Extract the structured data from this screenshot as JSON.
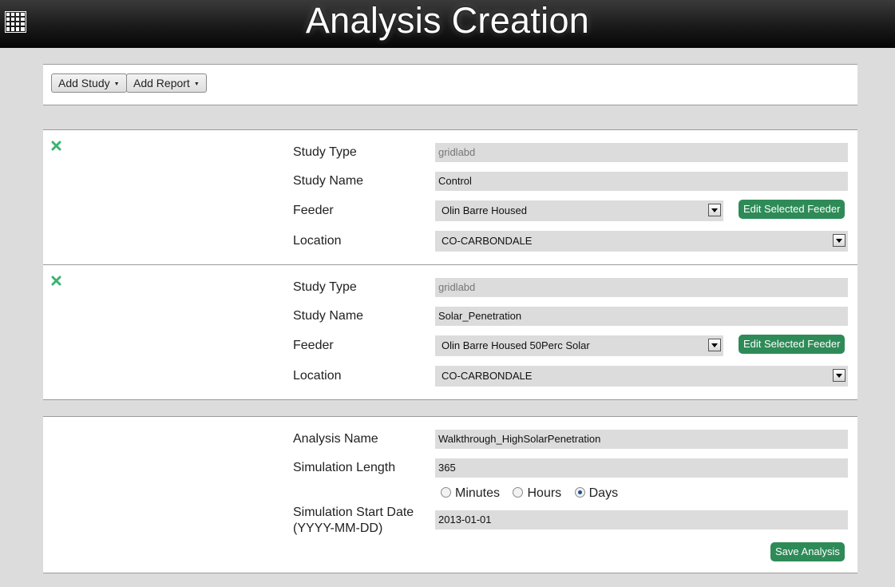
{
  "header": {
    "title": "Analysis Creation",
    "menu_icon": "grid-menu-icon"
  },
  "toolbar": {
    "add_study_label": "Add Study",
    "add_report_label": "Add Report"
  },
  "studies": [
    {
      "study_type_label": "Study Type",
      "study_type_value": "gridlabd",
      "study_name_label": "Study Name",
      "study_name_value": "Control",
      "feeder_label": "Feeder",
      "feeder_value": "Olin Barre Housed",
      "edit_feeder_label": "Edit Selected Feeder",
      "location_label": "Location",
      "location_value": "CO-CARBONDALE"
    },
    {
      "study_type_label": "Study Type",
      "study_type_value": "gridlabd",
      "study_name_label": "Study Name",
      "study_name_value": "Solar_Penetration",
      "feeder_label": "Feeder",
      "feeder_value": "Olin Barre Housed 50Perc Solar",
      "edit_feeder_label": "Edit Selected Feeder",
      "location_label": "Location",
      "location_value": "CO-CARBONDALE"
    }
  ],
  "analysis": {
    "name_label": "Analysis Name",
    "name_value": "Walkthrough_HighSolarPenetration",
    "length_label": "Simulation Length",
    "length_value": "365",
    "units": [
      {
        "label": "Minutes",
        "checked": false
      },
      {
        "label": "Hours",
        "checked": false
      },
      {
        "label": "Days",
        "checked": true
      }
    ],
    "start_date_label_line1": "Simulation Start Date",
    "start_date_label_line2": "(YYYY-MM-DD)",
    "start_date_value": "2013-01-01",
    "save_label": "Save Analysis"
  },
  "colors": {
    "accent_green": "#2e8b57",
    "remove_icon_green": "#3cb371",
    "field_gray": "#dcdcdc"
  }
}
